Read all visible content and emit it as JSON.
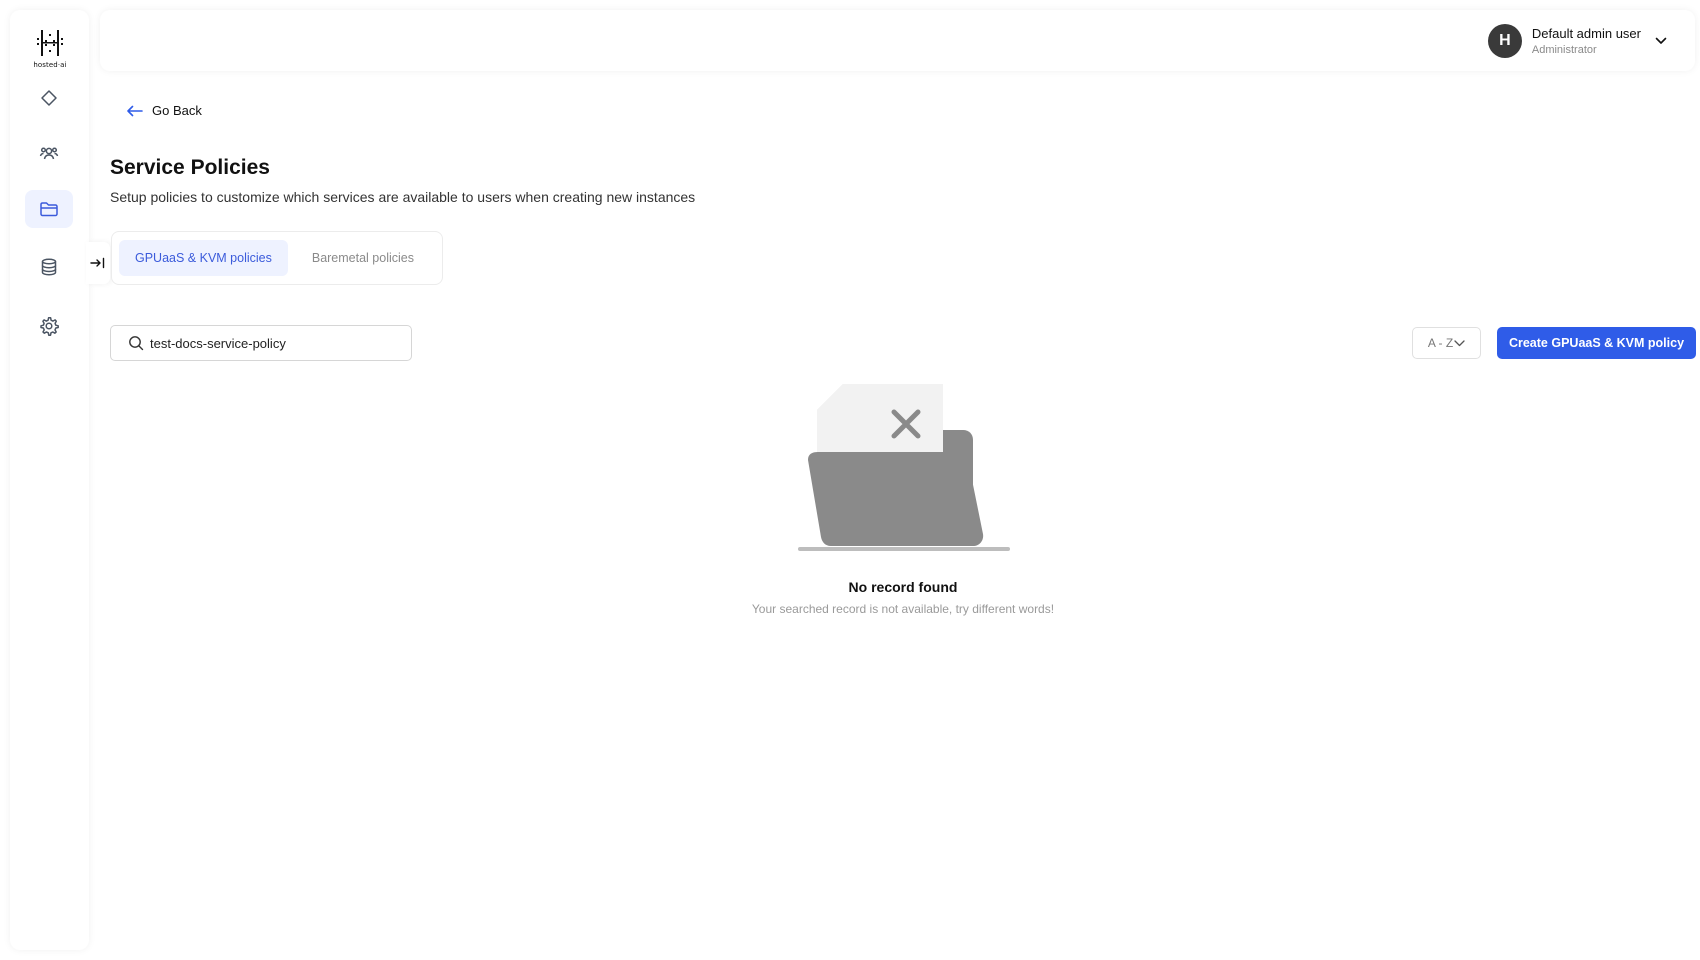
{
  "app": {
    "logo_text": "hosted·ai"
  },
  "sidebar": {
    "items": [
      {
        "name": "dashboard",
        "icon": "diamond-icon",
        "active": false
      },
      {
        "name": "users",
        "icon": "users-icon",
        "active": false
      },
      {
        "name": "policies",
        "icon": "folder-icon",
        "active": true
      },
      {
        "name": "storage",
        "icon": "database-icon",
        "active": false
      },
      {
        "name": "settings",
        "icon": "gear-icon",
        "active": false
      }
    ],
    "collapse_icon": "collapse-arrow-icon"
  },
  "header": {
    "user": {
      "avatar_initial": "H",
      "name": "Default admin user",
      "role": "Administrator"
    }
  },
  "navigation": {
    "go_back_label": "Go Back"
  },
  "page": {
    "title": "Service Policies",
    "subtitle": "Setup policies to customize which services are available to users when creating new instances"
  },
  "tabs": [
    {
      "label": "GPUaaS & KVM policies",
      "active": true
    },
    {
      "label": "Baremetal policies",
      "active": false
    }
  ],
  "search": {
    "value": "test-docs-service-policy",
    "placeholder": "Search"
  },
  "toolbar": {
    "sort_label": "A - Z",
    "create_label": "Create GPUaaS & KVM policy"
  },
  "empty_state": {
    "title": "No record found",
    "description": "Your searched record is not available, try different words!"
  },
  "colors": {
    "accent": "#2f5ce8",
    "active_tab_bg": "#eef2ff",
    "active_tab_text": "#3b5bdb",
    "avatar_bg": "#3a3a3a",
    "illustration_gray": "#8a8a8a"
  }
}
